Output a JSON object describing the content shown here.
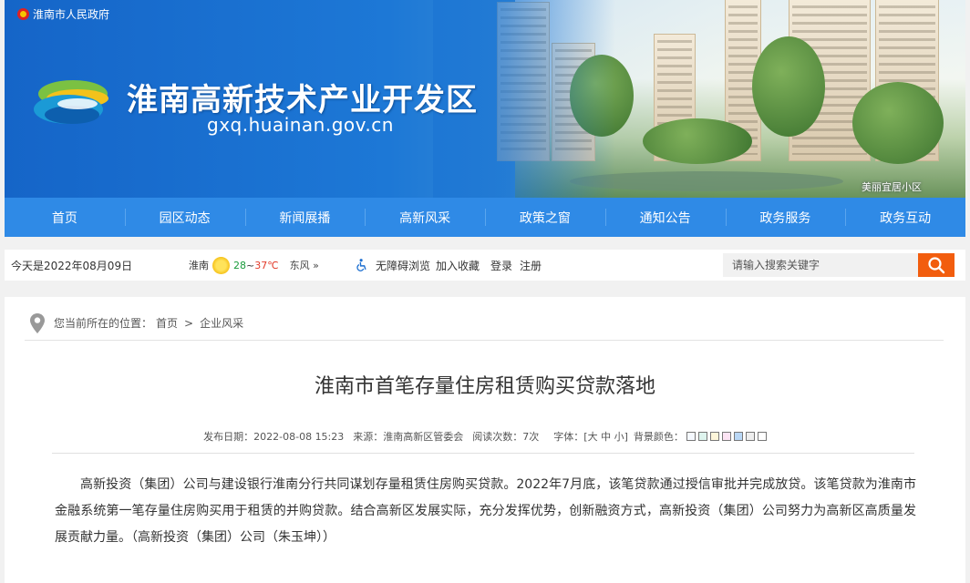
{
  "header": {
    "gov_link": "淮南市人民政府",
    "site_title": "淮南高新技术产业开发区",
    "site_url": "gxq.huainan.gov.cn",
    "banner_caption": "美丽宜居小区"
  },
  "nav": {
    "items": [
      {
        "label": "首页"
      },
      {
        "label": "园区动态"
      },
      {
        "label": "新闻展播"
      },
      {
        "label": "高新风采"
      },
      {
        "label": "政策之窗"
      },
      {
        "label": "通知公告"
      },
      {
        "label": "政务服务"
      },
      {
        "label": "政务互动"
      }
    ]
  },
  "infobar": {
    "date": "今天是2022年08月09日",
    "weather": {
      "city": "淮南",
      "icon": "sun-icon",
      "temp_low": "28",
      "temp_sep": "~",
      "temp_high": "37℃",
      "wind": "东风 »"
    },
    "accessibility": "无障碍浏览",
    "favorite": "加入收藏",
    "login": "登录",
    "register": "注册",
    "search": {
      "placeholder": "请输入搜索关键字",
      "button_icon": "search-icon"
    }
  },
  "breadcrumb": {
    "prefix": "您当前所在的位置：",
    "home": "首页",
    "separator": ">",
    "current": "企业风采"
  },
  "article": {
    "title": "淮南市首笔存量住房租赁购买贷款落地",
    "meta": {
      "publish": "发布日期：2022-08-08 15:23",
      "source": "来源：淮南高新区管委会",
      "views": "阅读次数：7次",
      "font_label": "字体：[",
      "font_large": "大",
      "font_medium": "中",
      "font_small": "小",
      "font_end": "]",
      "bg_label": "背景颜色："
    },
    "bg_colors": [
      "#f5f9ff",
      "#def4ee",
      "#fdf6da",
      "#fde4f4",
      "#b9d7f5",
      "#eeeeee",
      "#ffffff"
    ],
    "body": "高新投资（集团）公司与建设银行淮南分行共同谋划存量租赁住房购买贷款。2022年7月底，该笔贷款通过授信审批并完成放贷。该笔贷款为淮南市金融系统第一笔存量住房购买用于租赁的并购贷款。结合高新区发展实际，充分发挥优势，创新融资方式，高新投资（集团）公司努力为高新区高质量发展贡献力量。（高新投资（集团）公司（朱玉坤））"
  }
}
